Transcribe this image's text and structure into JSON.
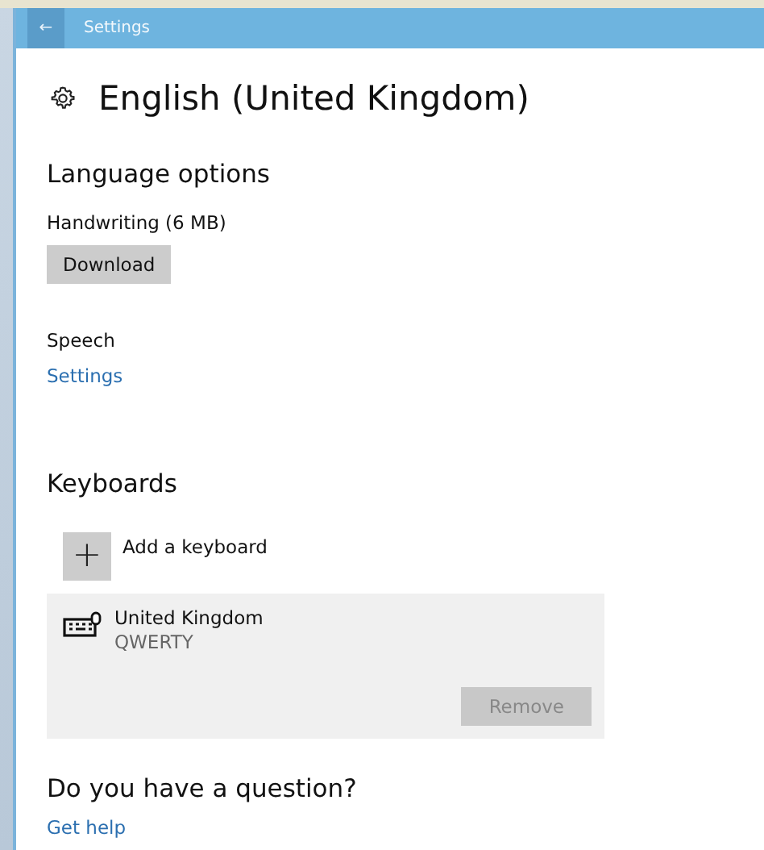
{
  "window": {
    "title": "Settings",
    "back": "←"
  },
  "heading": "English (United Kingdom)",
  "language_options": {
    "title": "Language options",
    "handwriting": {
      "label": "Handwriting (6 MB)",
      "button": "Download"
    },
    "speech": {
      "label": "Speech",
      "link": "Settings"
    }
  },
  "keyboards": {
    "title": "Keyboards",
    "add": {
      "icon": "+",
      "label": "Add a keyboard"
    },
    "items": [
      {
        "name": "United Kingdom",
        "layout": "QWERTY",
        "selected": true,
        "button": {
          "label": "Remove",
          "disabled": true
        }
      }
    ]
  },
  "question": {
    "title": "Do you have a question?",
    "link": "Get help"
  }
}
